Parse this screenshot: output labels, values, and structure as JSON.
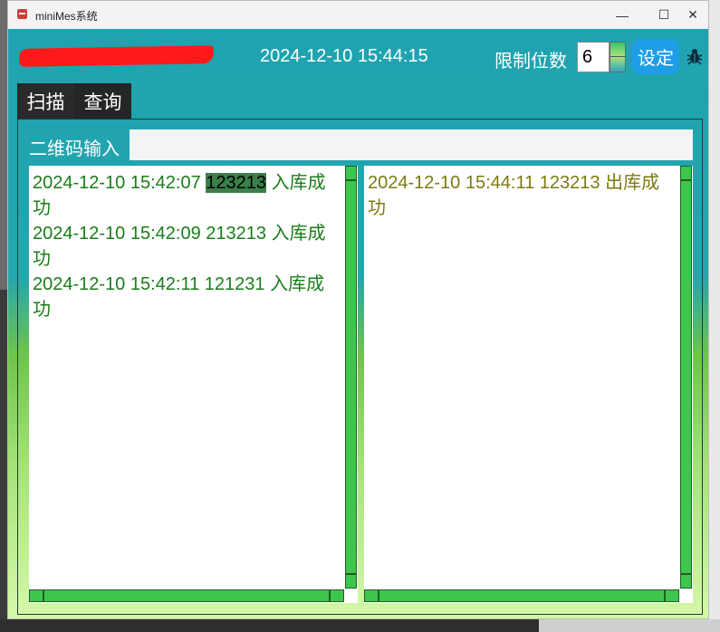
{
  "window": {
    "title": "miniMes系统"
  },
  "titlebar_buttons": {
    "minimize": "—",
    "maximize": "☐",
    "close": "✕"
  },
  "header": {
    "datetime": "2024-12-10 15:44:15",
    "limit_label": "限制位数",
    "limit_value": "6",
    "set_button": "设定"
  },
  "tabs": [
    {
      "label": "扫描",
      "active": true
    },
    {
      "label": "查询",
      "active": false
    }
  ],
  "scan": {
    "qr_label": "二维码输入",
    "qr_value": ""
  },
  "left_list": {
    "entries": [
      {
        "time": "2024-12-10 15:42:07",
        "code": "123213",
        "status": "入库成功",
        "highlight": true
      },
      {
        "time": "2024-12-10 15:42:09",
        "code": "213213",
        "status": "入库成功",
        "highlight": false
      },
      {
        "time": "2024-12-10 15:42:11",
        "code": "121231",
        "status": "入库成功",
        "highlight": false
      }
    ]
  },
  "right_list": {
    "entries": [
      {
        "time": "2024-12-10 15:44:11",
        "code": "123213",
        "status": "出库成功",
        "highlight": false
      }
    ]
  },
  "colors": {
    "in_stock_text": "#1a7e1a",
    "out_stock_text": "#7e7a12",
    "set_button": "#1e9ee8",
    "scrollbar": "#3ec64c"
  },
  "icons": {
    "bug": "bug-icon",
    "app": "app-icon"
  }
}
